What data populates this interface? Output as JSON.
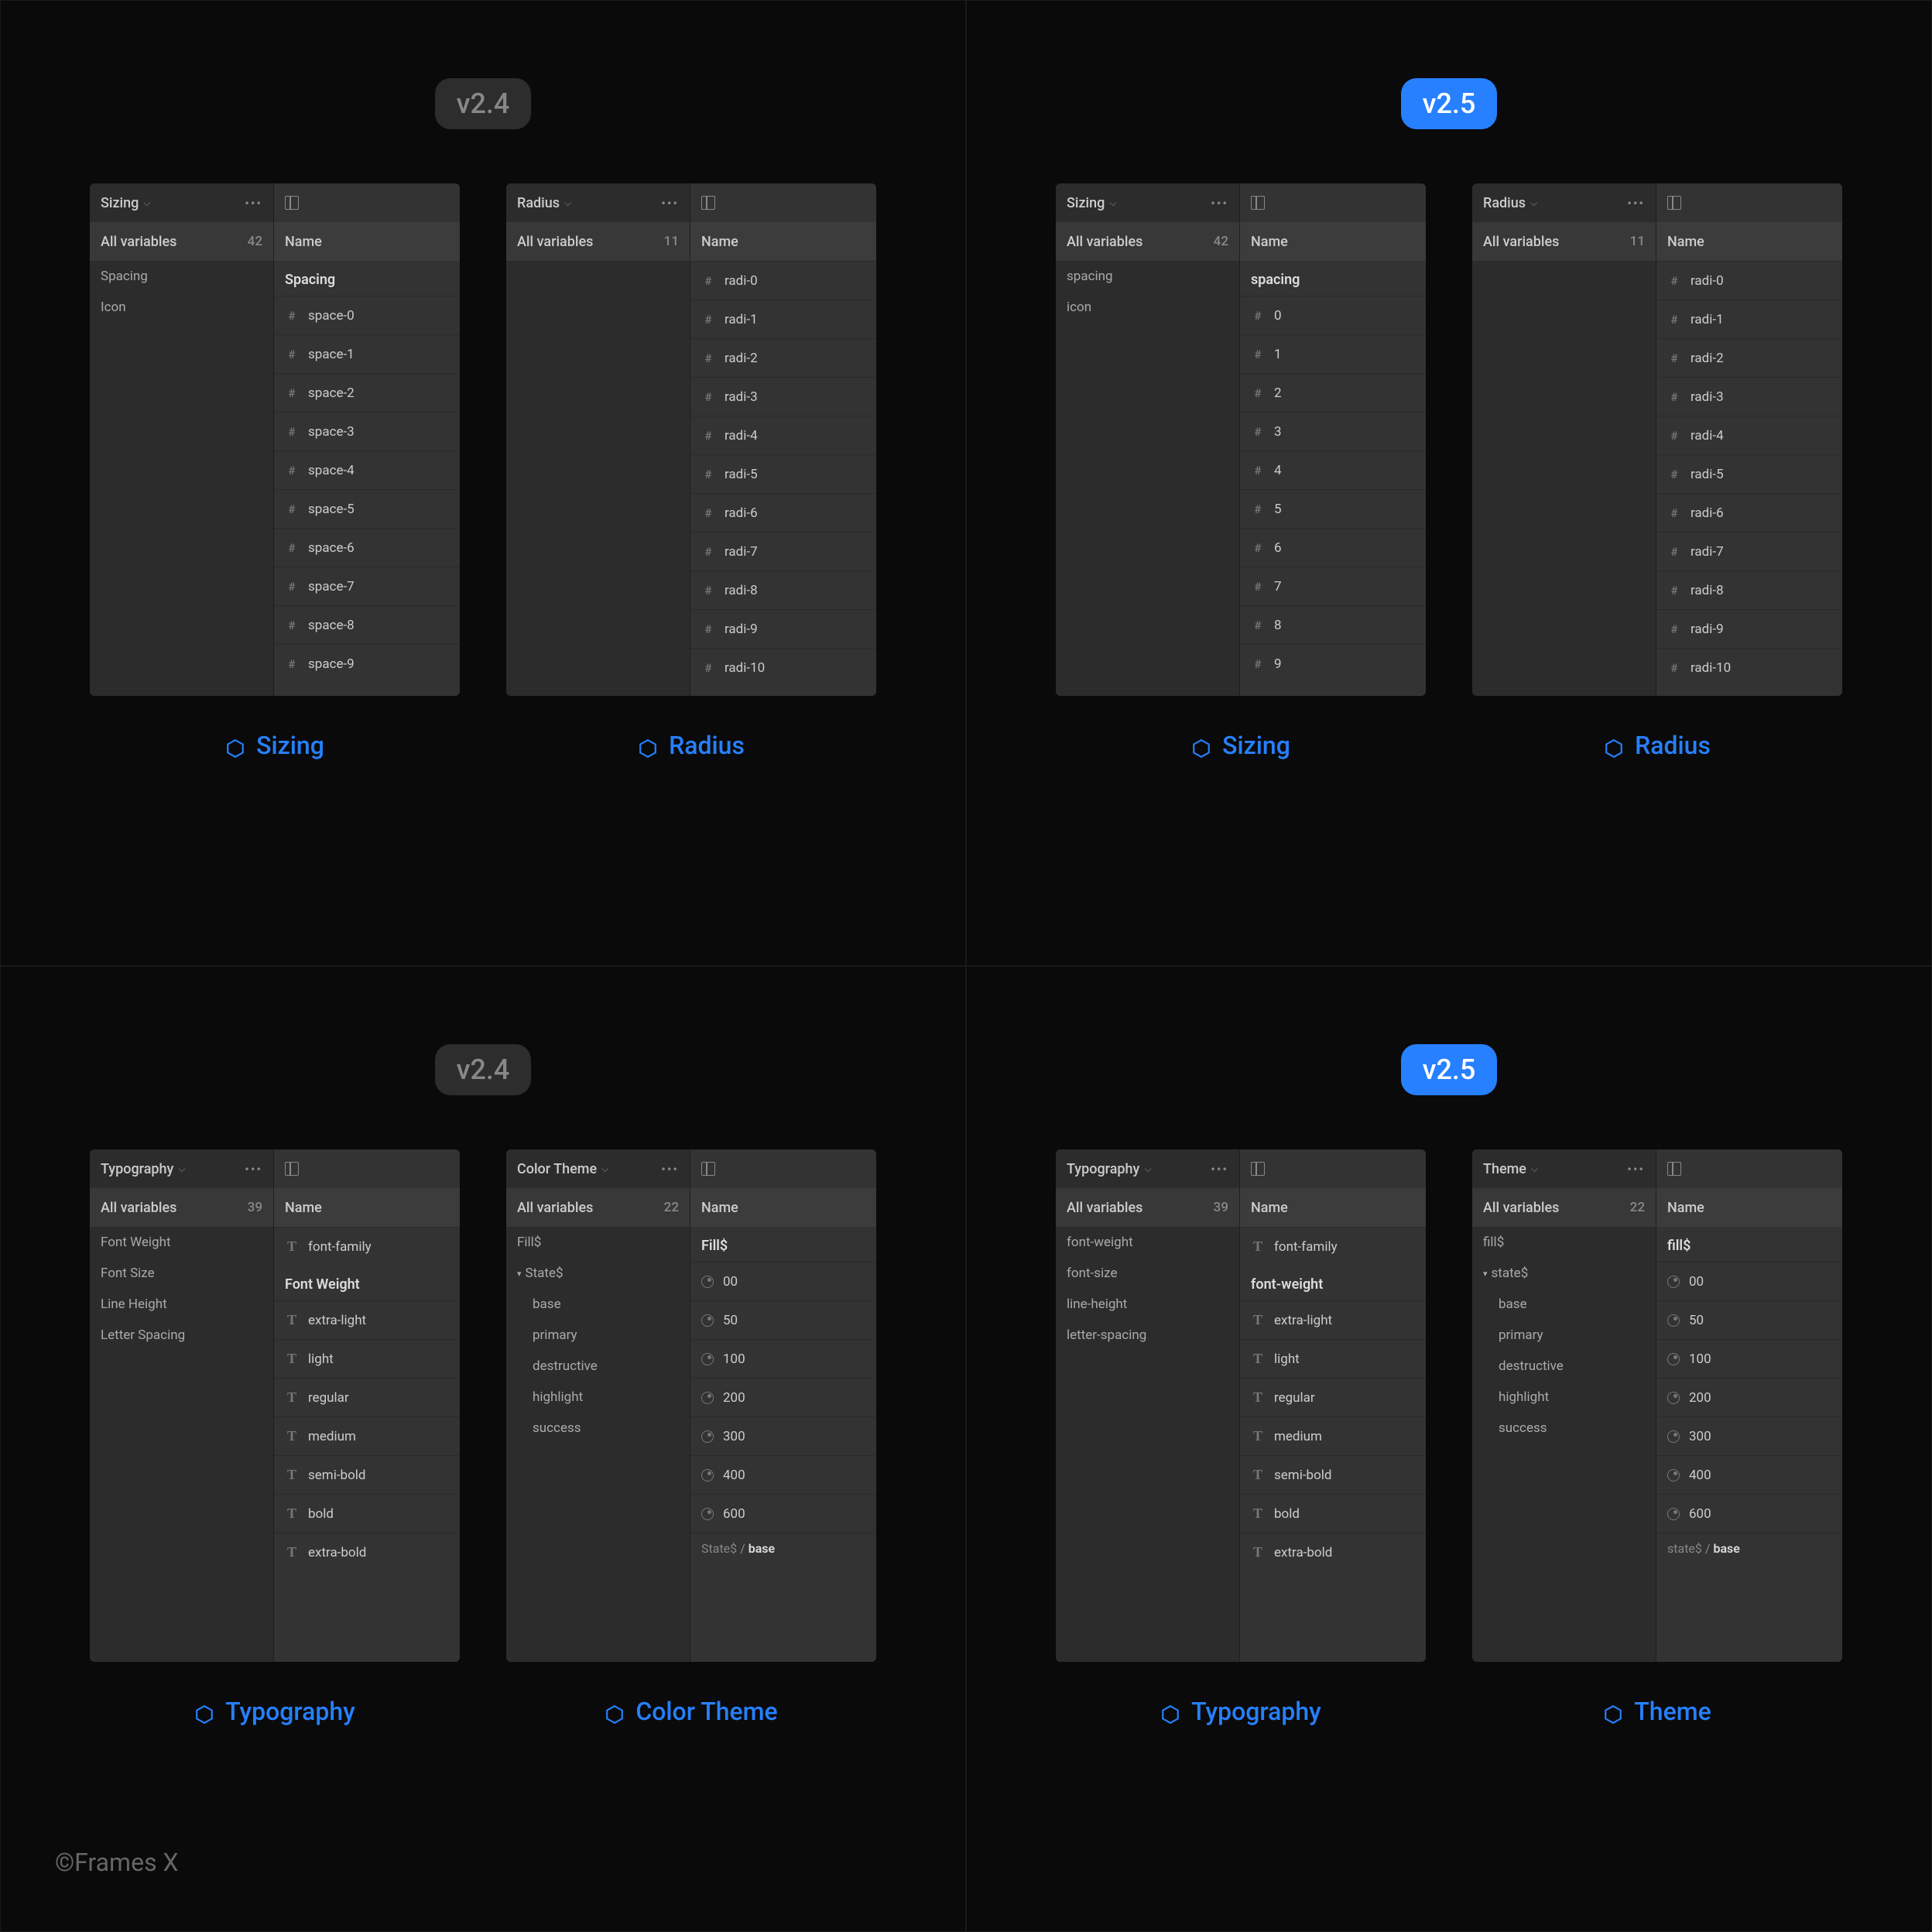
{
  "versions": {
    "v24": "v2.4",
    "v25": "v2.5"
  },
  "copyright": "©Frames X",
  "labels": {
    "sizing": "Sizing",
    "radius": "Radius",
    "typography": "Typography",
    "colortheme": "Color Theme",
    "theme": "Theme",
    "allvars": "All variables",
    "name": "Name"
  },
  "counts": {
    "sizing": "42",
    "radius": "11",
    "typography": "39",
    "colortheme": "22",
    "theme": "22"
  },
  "sizing_v24": {
    "sidebar": [
      "Spacing",
      "Icon"
    ],
    "group": "Spacing",
    "rows": [
      "space-0",
      "space-1",
      "space-2",
      "space-3",
      "space-4",
      "space-5",
      "space-6",
      "space-7",
      "space-8",
      "space-9"
    ]
  },
  "sizing_v25": {
    "sidebar": [
      "spacing",
      "icon"
    ],
    "group": "spacing",
    "rows": [
      "0",
      "1",
      "2",
      "3",
      "4",
      "5",
      "6",
      "7",
      "8",
      "9"
    ]
  },
  "radius": {
    "rows": [
      "radi-0",
      "radi-1",
      "radi-2",
      "radi-3",
      "radi-4",
      "radi-5",
      "radi-6",
      "radi-7",
      "radi-8",
      "radi-9",
      "radi-10"
    ]
  },
  "typo_v24": {
    "sidebar": [
      "Font Weight",
      "Font Size",
      "Line Height",
      "Letter Spacing"
    ],
    "ff": "font-family",
    "group": "Font Weight",
    "rows": [
      "extra-light",
      "light",
      "regular",
      "medium",
      "semi-bold",
      "bold",
      "extra-bold"
    ]
  },
  "typo_v25": {
    "sidebar": [
      "font-weight",
      "font-size",
      "line-height",
      "letter-spacing"
    ],
    "ff": "font-family",
    "group": "font-weight",
    "rows": [
      "extra-light",
      "light",
      "regular",
      "medium",
      "semi-bold",
      "bold",
      "extra-bold"
    ]
  },
  "color_v24": {
    "side_fill": "Fill$",
    "side_state": "State$",
    "states": [
      "base",
      "primary",
      "destructive",
      "highlight",
      "success"
    ],
    "group": "Fill$",
    "rows": [
      "00",
      "50",
      "100",
      "200",
      "300",
      "400",
      "600"
    ],
    "sub_prefix": "State$ / ",
    "sub_bold": "base"
  },
  "color_v25": {
    "side_fill": "fill$",
    "side_state": "state$",
    "states": [
      "base",
      "primary",
      "destructive",
      "highlight",
      "success"
    ],
    "group": "fill$",
    "rows": [
      "00",
      "50",
      "100",
      "200",
      "300",
      "400",
      "600"
    ],
    "sub_prefix": "state$ / ",
    "sub_bold": "base"
  }
}
